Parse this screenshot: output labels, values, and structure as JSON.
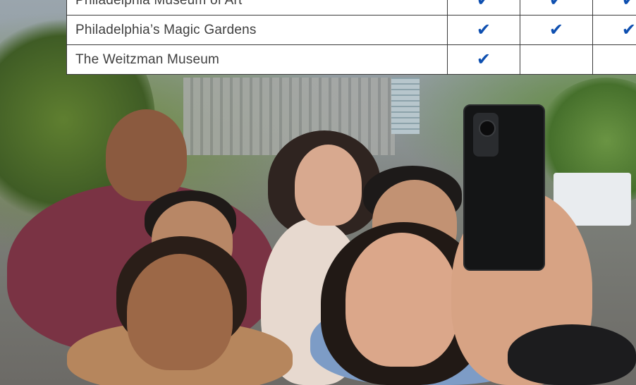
{
  "attractions_table": {
    "rows": [
      {
        "name": "Philadelphia Museum of Art",
        "checks": [
          true,
          true,
          true
        ]
      },
      {
        "name": "Philadelphia’s Magic Gardens",
        "checks": [
          true,
          true,
          true
        ]
      },
      {
        "name": "The Weitzman Museum",
        "checks": [
          true,
          false,
          false
        ]
      }
    ],
    "check_glyph": "✔",
    "check_color": "#0e4fb0",
    "check_icon": "checkmark-icon"
  },
  "photo": {
    "image": "group-selfie-on-tour-bus"
  }
}
